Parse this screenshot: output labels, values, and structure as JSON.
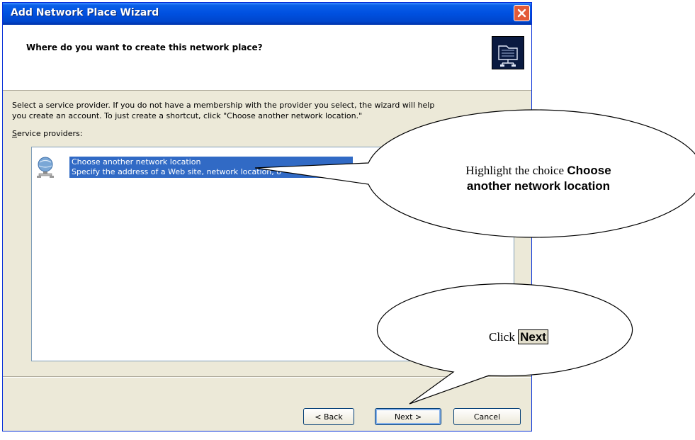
{
  "window": {
    "title": "Add Network Place Wizard",
    "header_title": "Where do you want to create this network place?"
  },
  "content": {
    "description_line1": "Select a service provider.  If you do not have a membership with the provider you select, the wizard will help",
    "description_line2": "you create an account.  To just create a shortcut, click \"Choose another network location.\"",
    "list_label_first": "S",
    "list_label_rest": "ervice providers:",
    "list_items": [
      {
        "title": "Choose another network location",
        "subtitle": "Specify the address of a Web site, network location, o"
      }
    ]
  },
  "buttons": {
    "back": "< Back",
    "next": "Next >",
    "cancel": "Cancel"
  },
  "callouts": {
    "highlight_prefix": "Highlight the choice ",
    "highlight_emph1": "Choose",
    "highlight_emph2": "another network location",
    "click_prefix": "Click ",
    "click_emph": "Next"
  },
  "colors": {
    "titlebar": "#0050e0",
    "selection": "#316ac5",
    "dialog_bg": "#ece9d8"
  }
}
